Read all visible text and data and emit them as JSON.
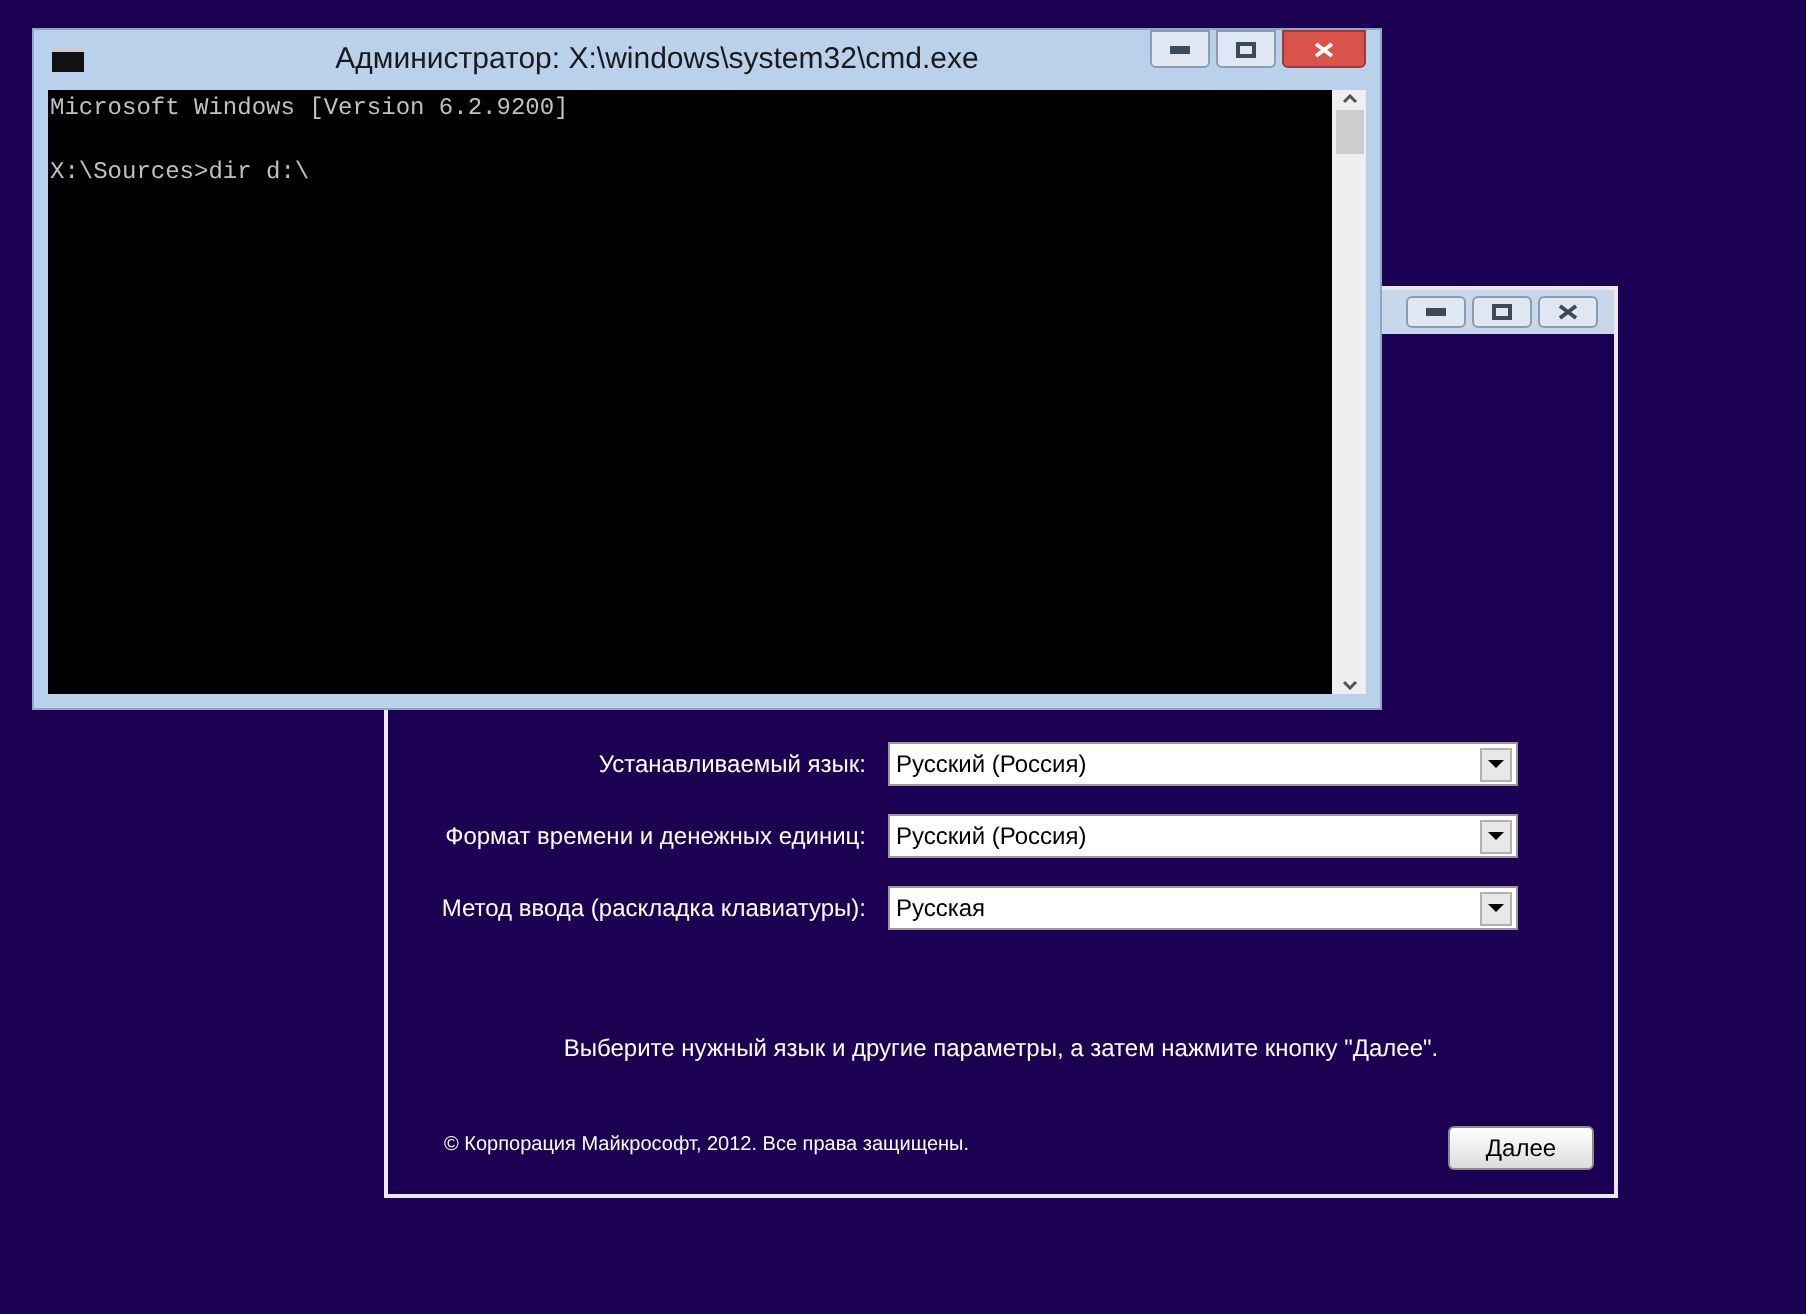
{
  "setup_window": {
    "fields": [
      {
        "label": "Устанавливаемый язык:",
        "value": "Русский (Россия)"
      },
      {
        "label": "Формат времени и денежных единиц:",
        "value": "Русский (Россия)"
      },
      {
        "label": "Метод ввода (раскладка клавиатуры):",
        "value": "Русская"
      }
    ],
    "message": "Выберите нужный язык и другие параметры, а затем нажмите кнопку \"Далее\".",
    "copyright": "© Корпорация Майкрософт, 2012. Все права защищены.",
    "next_button": "Далее"
  },
  "cmd_window": {
    "title": "Администратор: X:\\windows\\system32\\cmd.exe",
    "console_text": "Microsoft Windows [Version 6.2.9200]\n\nX:\\Sources>dir d:\\"
  }
}
